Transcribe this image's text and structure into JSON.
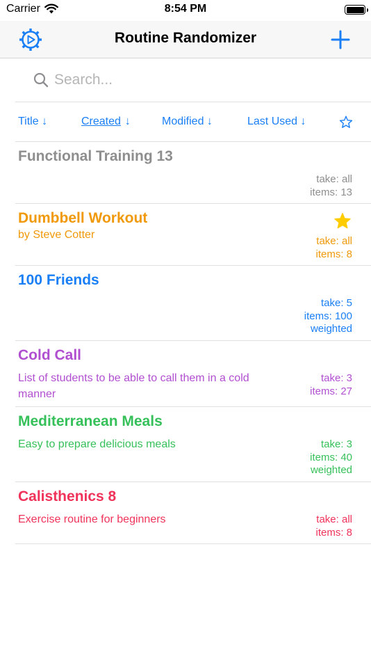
{
  "status_bar": {
    "carrier": "Carrier",
    "time": "8:54 PM"
  },
  "nav": {
    "title": "Routine Randomizer"
  },
  "search": {
    "placeholder": "Search..."
  },
  "sort": {
    "title": "Title ↓",
    "created": "Created",
    "modified": "Modified ↓",
    "last_used": "Last Used ↓",
    "active": "created"
  },
  "colors": {
    "accent": "#1a7ff5",
    "gray": "#8e8e8e",
    "orange": "#f0990a",
    "blue": "#1a7ff5",
    "purple": "#b14fd1",
    "green": "#36c05a",
    "red": "#f0335a",
    "star": "#ffcc00"
  },
  "routines": [
    {
      "title": "Functional Training 13",
      "description": "",
      "take": "take: all",
      "items": "items: 13",
      "extra": "",
      "color": "#8e8e8e",
      "favorite": false
    },
    {
      "title": "Dumbbell Workout",
      "description": "by Steve Cotter",
      "take": "take: all",
      "items": "items: 8",
      "extra": "",
      "color": "#f0990a",
      "favorite": true
    },
    {
      "title": "100 Friends",
      "description": "",
      "take": "take: 5",
      "items": "items: 100",
      "extra": "weighted",
      "color": "#1a7ff5",
      "favorite": false
    },
    {
      "title": "Cold Call",
      "description": "List of students to be able to call them in a cold manner",
      "take": "take: 3",
      "items": "items: 27",
      "extra": "",
      "color": "#b14fd1",
      "favorite": false
    },
    {
      "title": "Mediterranean Meals",
      "description": "Easy to prepare delicious meals",
      "take": "take: 3",
      "items": "items: 40",
      "extra": "weighted",
      "color": "#36c05a",
      "favorite": false
    },
    {
      "title": "Calisthenics 8",
      "description": "Exercise routine for beginners",
      "take": "take: all",
      "items": "items: 8",
      "extra": "",
      "color": "#f0335a",
      "favorite": false
    }
  ]
}
